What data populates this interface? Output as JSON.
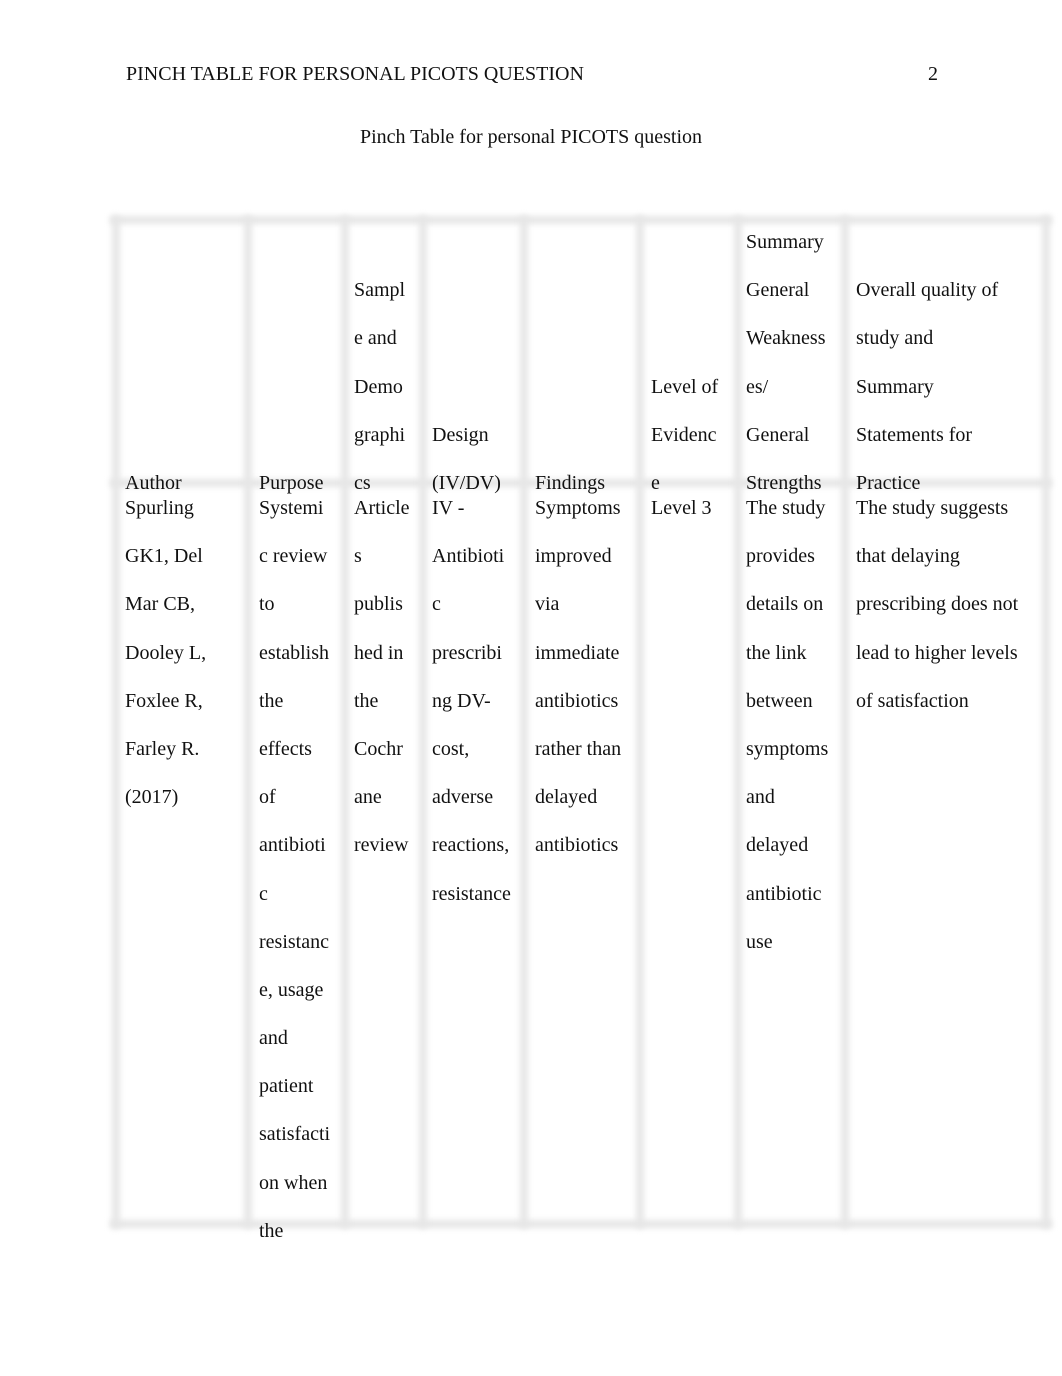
{
  "header": {
    "running_head": "PINCH TABLE FOR PERSONAL PICOTS QUESTION",
    "page_number": "2"
  },
  "title": "Pinch Table for personal PICOTS question",
  "table": {
    "columns": [
      {
        "key": "author",
        "header_lines": [
          "Author"
        ]
      },
      {
        "key": "purpose",
        "header_lines": [
          "Purpose"
        ]
      },
      {
        "key": "sample",
        "header_lines": [
          "Sampl",
          "e and",
          "Demo",
          "graphi",
          "cs"
        ]
      },
      {
        "key": "design",
        "header_lines": [
          "Design",
          "(IV/DV)"
        ]
      },
      {
        "key": "findings",
        "header_lines": [
          "Findings"
        ]
      },
      {
        "key": "level",
        "header_lines": [
          "Level of",
          "Evidenc",
          "e"
        ]
      },
      {
        "key": "summary",
        "header_lines": [
          "Summary",
          "General",
          "Weakness",
          "es/",
          "General",
          "Strengths"
        ]
      },
      {
        "key": "quality",
        "header_lines": [
          "Overall quality of",
          "study and",
          "Summary",
          "Statements for",
          "Practice"
        ]
      }
    ],
    "rows": [
      {
        "author": [
          "Spurling",
          "GK1, Del",
          "Mar CB,",
          "Dooley L,",
          "Foxlee R,",
          "Farley R.",
          "(2017)"
        ],
        "purpose": [
          "Systemi",
          "c review",
          "to",
          "establish",
          "the",
          "effects",
          "of",
          "antibioti",
          "c",
          "resistanc",
          "e, usage",
          "and",
          "patient",
          "satisfacti",
          "on when",
          "the"
        ],
        "sample": [
          "Article",
          "s",
          "publis",
          "hed in",
          "the",
          "Cochr",
          "ane",
          "review"
        ],
        "design": [
          "IV -",
          "Antibioti",
          "c",
          "prescribi",
          "ng DV-",
          "cost,",
          "adverse",
          "reactions,",
          "resistance"
        ],
        "findings": [
          "Symptoms",
          "improved",
          "via",
          "immediate",
          "antibiotics",
          "rather than",
          "delayed",
          "antibiotics"
        ],
        "level": [
          "Level 3"
        ],
        "summary": [
          "The study",
          "provides",
          "details on",
          "the link",
          "between",
          "symptoms",
          "and",
          "delayed",
          "antibiotic",
          "use"
        ],
        "quality": [
          "The study suggests",
          "that delaying",
          "prescribing does not",
          "lead to higher levels",
          "of satisfaction"
        ]
      }
    ]
  }
}
